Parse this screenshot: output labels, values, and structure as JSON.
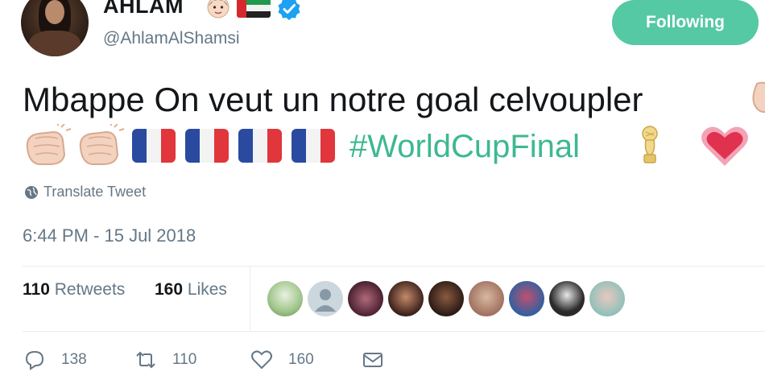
{
  "tweet": {
    "author": {
      "name": "AHLAM",
      "handle": "@AhlamAlShamsi",
      "verified": true
    },
    "follow_button_label": "Following",
    "text_line1": "Mbappe On veut un notre goal celvoupler",
    "hashtag": "#WorldCupFinal",
    "translate_label": "Translate Tweet",
    "timestamp": "6:44 PM - 15 Jul 2018",
    "stats": {
      "retweets_count": "110",
      "retweets_label": "Retweets",
      "likes_count": "160",
      "likes_label": "Likes"
    },
    "actions": {
      "reply_count": "138",
      "retweet_count": "110",
      "like_count": "160"
    }
  },
  "colors": {
    "accent": "#55c8a4",
    "hashtag": "#3db892",
    "secondary_text": "#657786",
    "verified": "#1da1f2"
  },
  "icons": [
    "girl-emoji-icon",
    "uae-flag-icon",
    "verified-badge-icon",
    "clapping-hands-icon",
    "france-flag-icon",
    "trophy-icon",
    "heart-icon",
    "globe-icon",
    "reply-icon",
    "retweet-icon",
    "like-icon",
    "message-icon"
  ]
}
